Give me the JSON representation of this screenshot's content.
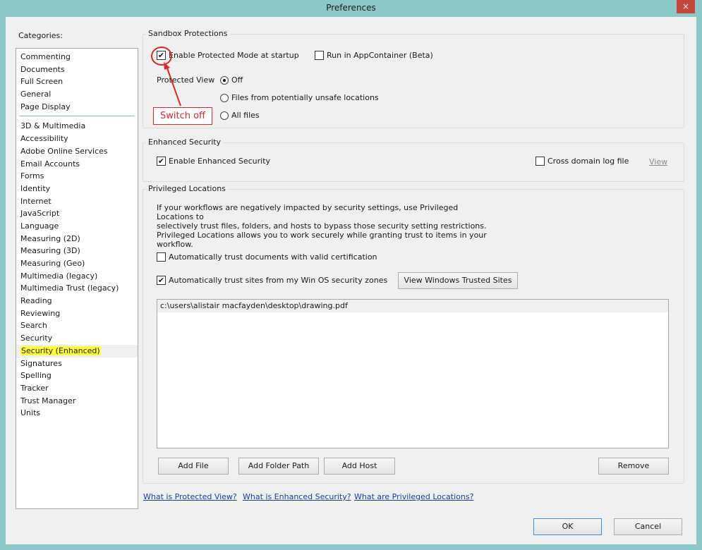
{
  "window": {
    "title": "Preferences",
    "close": "×"
  },
  "categories": {
    "label": "Categories:",
    "group1": [
      "Commenting",
      "Documents",
      "Full Screen",
      "General",
      "Page Display"
    ],
    "group2": [
      "3D & Multimedia",
      "Accessibility",
      "Adobe Online Services",
      "Email Accounts",
      "Forms",
      "Identity",
      "Internet",
      "JavaScript",
      "Language",
      "Measuring (2D)",
      "Measuring (3D)",
      "Measuring (Geo)",
      "Multimedia (legacy)",
      "Multimedia Trust (legacy)",
      "Reading",
      "Reviewing",
      "Search",
      "Security",
      "Security (Enhanced)",
      "Signatures",
      "Spelling",
      "Tracker",
      "Trust Manager",
      "Units"
    ],
    "selected": "Security (Enhanced)"
  },
  "sandbox": {
    "title": "Sandbox Protections",
    "enable_protected_mode": "Enable Protected Mode at startup",
    "enable_protected_mode_checked": true,
    "run_appcontainer": "Run in AppContainer (Beta)",
    "run_appcontainer_checked": false,
    "protected_view_label": "Protected View",
    "pv_off": "Off",
    "pv_unsafe": "Files from potentially unsafe locations",
    "pv_all": "All files",
    "pv_selected": "Off"
  },
  "annotation": {
    "label": "Switch off",
    "color": "#d42a2a"
  },
  "enhanced": {
    "title": "Enhanced Security",
    "enable_enhanced": "Enable Enhanced Security",
    "enable_enhanced_checked": true,
    "cross_domain": "Cross domain log file",
    "cross_domain_checked": false,
    "view_link": "View"
  },
  "privileged": {
    "title": "Privileged Locations",
    "description_lines": [
      "If your workflows are negatively impacted by security settings, use Privileged Locations to",
      "selectively trust files, folders, and hosts to bypass those security setting restrictions.",
      "Privileged Locations allows you to work securely while granting trust to items in your",
      "workflow."
    ],
    "auto_trust_cert": "Automatically trust documents with valid certification",
    "auto_trust_cert_checked": false,
    "auto_trust_sites": "Automatically trust sites from my Win OS security zones",
    "auto_trust_sites_checked": true,
    "view_trusted_sites": "View Windows Trusted Sites",
    "locations": [
      "c:\\users\\alistair macfayden\\desktop\\drawing.pdf"
    ],
    "add_file": "Add File",
    "add_folder_path": "Add Folder Path",
    "add_host": "Add Host",
    "remove": "Remove"
  },
  "links": {
    "protected_view": "What is Protected View?",
    "enhanced_security": "What is Enhanced Security?",
    "privileged_locations": "What are Privileged Locations?"
  },
  "footer": {
    "ok": "OK",
    "cancel": "Cancel"
  },
  "colors": {
    "title_bar": "#8cc8c8",
    "close_button": "#c7463c",
    "highlight": "#ffff33",
    "link": "#1b3c9e"
  }
}
